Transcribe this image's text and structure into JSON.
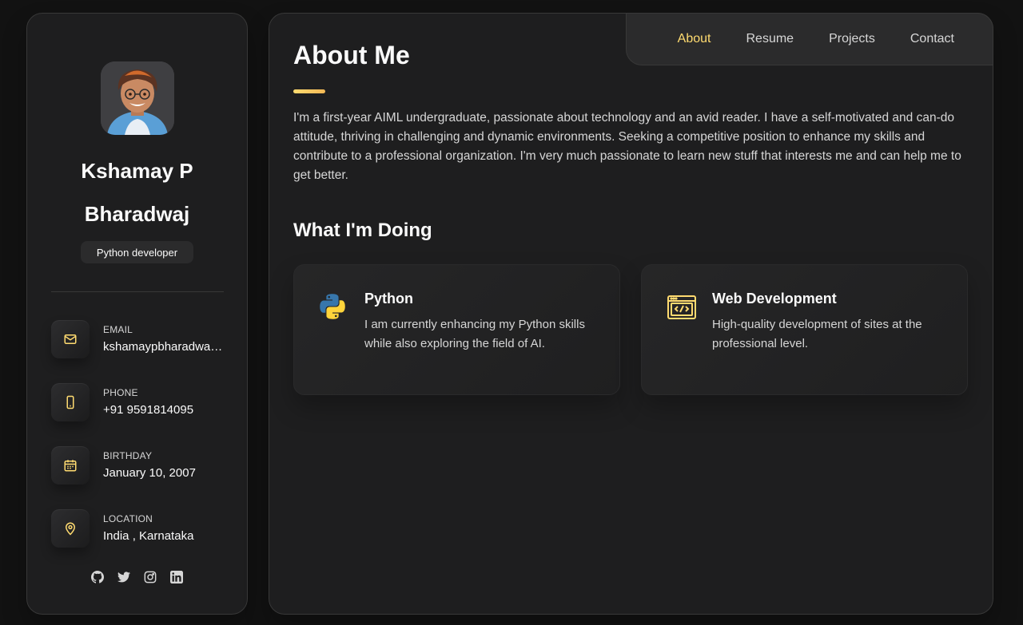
{
  "profile": {
    "name": "Kshamay P Bharadwaj",
    "title": "Python developer"
  },
  "contacts": [
    {
      "label": "Email",
      "value": "kshamaypbharadwaj@gmail.com",
      "icon": "mail-icon"
    },
    {
      "label": "Phone",
      "value": "+91 9591814095",
      "icon": "phone-icon"
    },
    {
      "label": "Birthday",
      "value": "January 10, 2007",
      "icon": "calendar-icon"
    },
    {
      "label": "Location",
      "value": "India , Karnataka",
      "icon": "location-icon"
    }
  ],
  "social": [
    "github-icon",
    "twitter-icon",
    "instagram-icon",
    "linkedin-icon"
  ],
  "nav": {
    "items": [
      "About",
      "Resume",
      "Projects",
      "Contact"
    ],
    "active": "About"
  },
  "about": {
    "heading": "About Me",
    "text": "I'm a first-year AIML undergraduate, passionate about technology and an avid reader. I have a self-motivated and can-do attitude, thriving in challenging and dynamic environments. Seeking a competitive position to enhance my skills and contribute to a professional organization. I'm very much passionate to learn new stuff that interests me and can help me to get better."
  },
  "doing": {
    "heading": "What I'm Doing",
    "services": [
      {
        "title": "Python",
        "text": "I am currently enhancing my Python skills while also exploring the field of AI.",
        "icon": "python-logo-icon"
      },
      {
        "title": "Web Development",
        "text": "High-quality development of sites at the professional level.",
        "icon": "web-dev-icon"
      }
    ]
  },
  "colors": {
    "accent": "#ffdb70",
    "background": "#121212",
    "card": "#1e1e1f"
  }
}
